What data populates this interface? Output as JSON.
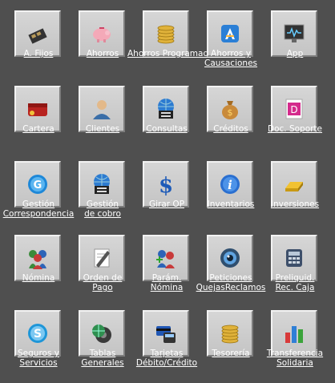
{
  "items": [
    {
      "id": "activos-fijos",
      "label": "A. Fijos",
      "icon": "fixed-assets-icon"
    },
    {
      "id": "ahorros",
      "label": "Ahorros",
      "icon": "piggy-bank-icon"
    },
    {
      "id": "ahorros-programados",
      "label": "Ahorros Programados",
      "icon": "coin-stack-icon"
    },
    {
      "id": "ahorros-causaciones",
      "label": "Ahorros y Causaciones",
      "icon": "app-a-icon"
    },
    {
      "id": "app",
      "label": "App",
      "icon": "monitor-icon"
    },
    {
      "id": "cartera",
      "label": "Cartera",
      "icon": "wallet-icon"
    },
    {
      "id": "clientes",
      "label": "Clientes",
      "icon": "user-icon"
    },
    {
      "id": "consultas",
      "label": "Consultas",
      "icon": "globe-printer-icon"
    },
    {
      "id": "creditos",
      "label": "Créditos",
      "icon": "money-bag-icon"
    },
    {
      "id": "doc-soporte",
      "label": "Doc. Soporte",
      "icon": "document-d-icon"
    },
    {
      "id": "gestion-correspondencia",
      "label": "Gestión Correspondencia",
      "icon": "g-circle-icon"
    },
    {
      "id": "gestion-cobro",
      "label": "Gestión de cobro",
      "icon": "globe-printer-icon"
    },
    {
      "id": "girar-op",
      "label": "Girar OP",
      "icon": "dollar-sign-icon"
    },
    {
      "id": "inventarios",
      "label": "Inventarios",
      "icon": "info-icon"
    },
    {
      "id": "inversiones",
      "label": "Inversiones",
      "icon": "gold-bar-icon"
    },
    {
      "id": "nomina",
      "label": "Nómina",
      "icon": "users-group-icon"
    },
    {
      "id": "orden-pago",
      "label": "Orden de Pago",
      "icon": "pencil-paper-icon"
    },
    {
      "id": "param-nomina",
      "label": "Parám. Nómina",
      "icon": "users-add-icon"
    },
    {
      "id": "peticiones",
      "label": "Peticiones QuejasReclamos",
      "icon": "eye-icon"
    },
    {
      "id": "preliquid",
      "label": "Preliquid. Rec. Caja",
      "icon": "calculator-icon"
    },
    {
      "id": "seguros",
      "label": "Seguros y Servicios",
      "icon": "s-circle-icon"
    },
    {
      "id": "tablas-generales",
      "label": "Tablas Generales",
      "icon": "globe-gear-icon"
    },
    {
      "id": "tarjetas",
      "label": "Tarjetas Débito/Crédito",
      "icon": "card-machine-icon"
    },
    {
      "id": "tesoreria",
      "label": "Tesorería",
      "icon": "coin-stack-icon"
    },
    {
      "id": "transferencia",
      "label": "Transferencia Solidaria",
      "icon": "bar-chart-icon"
    }
  ],
  "colors": {
    "background": "#4f4f4f",
    "button_face": "#cfcfcf",
    "label_text": "#ffffff"
  }
}
